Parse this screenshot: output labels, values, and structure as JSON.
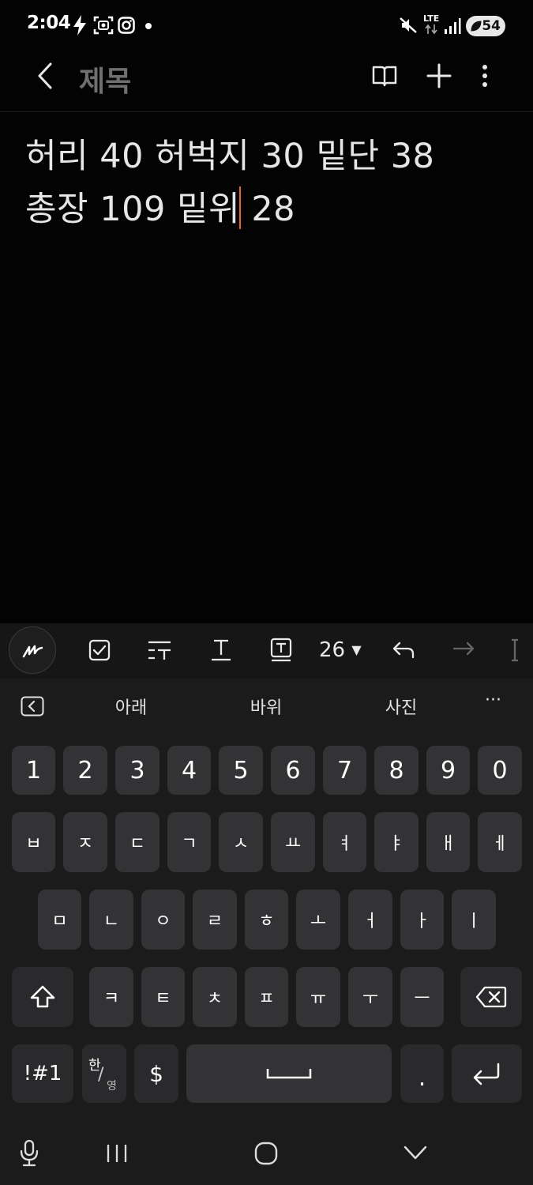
{
  "status_bar": {
    "time": "2:04",
    "network": "LTE",
    "battery": "54"
  },
  "app_bar": {
    "title": "제목"
  },
  "note": {
    "line1": "허리 40 허벅지 30 밑단 38",
    "line2_before_cursor": "총장 109 밑위 ",
    "line2_after_cursor": "28"
  },
  "format_toolbar": {
    "font_size": "26"
  },
  "suggestions": {
    "items": [
      "아래",
      "바위",
      "사진"
    ],
    "more": "···"
  },
  "keyboard": {
    "row_numbers": [
      "1",
      "2",
      "3",
      "4",
      "5",
      "6",
      "7",
      "8",
      "9",
      "0"
    ],
    "row1": [
      "ㅂ",
      "ㅈ",
      "ㄷ",
      "ㄱ",
      "ㅅ",
      "ㅛ",
      "ㅕ",
      "ㅑ",
      "ㅐ",
      "ㅔ"
    ],
    "row2": [
      "ㅁ",
      "ㄴ",
      "ㅇ",
      "ㄹ",
      "ㅎ",
      "ㅗ",
      "ㅓ",
      "ㅏ",
      "ㅣ"
    ],
    "row3": [
      "ㅋ",
      "ㅌ",
      "ㅊ",
      "ㅍ",
      "ㅠ",
      "ㅜ",
      "ㅡ"
    ],
    "symbols_label": "!#1",
    "lang_top": "한",
    "lang_bottom": "영",
    "currency": "$",
    "period": "."
  }
}
